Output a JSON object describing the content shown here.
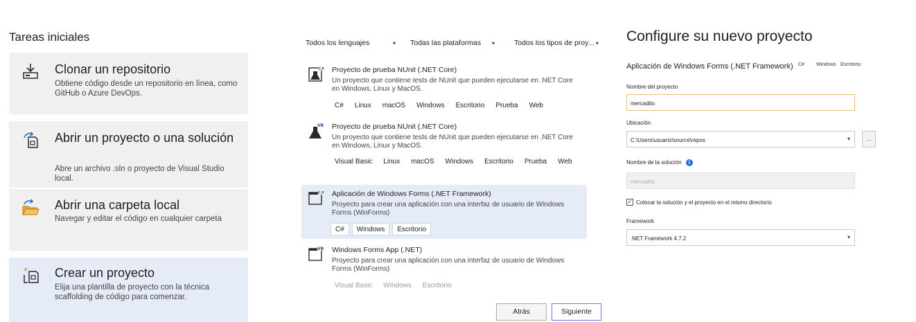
{
  "start": {
    "title": "Tareas iniciales",
    "tasks": [
      {
        "icon": "clone-icon",
        "title": "Clonar un repositorio",
        "desc": "Obtiene código desde un repositorio en línea, como GitHub o Azure DevOps."
      },
      {
        "icon": "open-project-icon",
        "title": "Abrir un proyecto o una solución",
        "desc": "Abre un archivo .sln o proyecto de Visual Studio local."
      },
      {
        "icon": "open-folder-icon",
        "title": "Abrir una carpeta local",
        "desc": "Navegar y editar el código en cualquier carpeta"
      },
      {
        "icon": "new-project-icon",
        "title": "Crear un proyecto",
        "desc": "Elija una plantilla de proyecto con la técnica scaffolding de código para comenzar."
      }
    ]
  },
  "templates": {
    "filters": {
      "language": "Todos los lenguajes",
      "platform": "Todas las plataformas",
      "type": "Todos los tipos de proy..."
    },
    "items": [
      {
        "icon": "csharp-test-icon",
        "name": "Proyecto de prueba NUnit (.NET Core)",
        "desc": "Un proyecto que contiene tests de NUnit que pueden ejecutarse en .NET Core en Windows, Linux y MacOS.",
        "tags": [
          "C#",
          "Linux",
          "macOS",
          "Windows",
          "Escritorio",
          "Prueba",
          "Web"
        ]
      },
      {
        "icon": "vb-test-icon",
        "name": "Proyecto de prueba NUnit (.NET Core)",
        "desc": "Un proyecto que contiene tests de NUnit que pueden ejecutarse en .NET Core en Windows, Linux y MacOS.",
        "tags": [
          "Visual Basic",
          "Linux",
          "macOS",
          "Windows",
          "Escritorio",
          "Prueba",
          "Web"
        ]
      },
      {
        "icon": "csharp-winforms-icon",
        "name": "Aplicación de Windows Forms (.NET Framework)",
        "desc": "Proyecto para crear una aplicación con una interfaz de usuario de Windows Forms (WinForms)",
        "tags": [
          "C#",
          "Windows",
          "Escritorio"
        ]
      },
      {
        "icon": "vb-winforms-icon",
        "name": "Windows Forms App (.NET)",
        "desc": "Proyecto para crear una aplicación con una interfaz de usuario de Windows Forms (WinForms)",
        "tags": [
          "Visual Basic",
          "Windows",
          "Escritorio"
        ]
      }
    ],
    "back_label": "Atrás",
    "next_label": "Siguiente"
  },
  "configure": {
    "title": "Configure su nuevo proyecto",
    "template_name": "Aplicación de Windows Forms (.NET Framework)",
    "template_tags": [
      "C#",
      "Windows",
      "Escritorio"
    ],
    "project_name_label": "Nombre del proyecto",
    "project_name_value": "mercadito",
    "location_label": "Ubicación",
    "location_value": "C:\\Users\\usuario\\source\\repos",
    "browse_label": "...",
    "solution_name_label": "Nombre de la solución",
    "solution_name_value": "mercadito",
    "same_dir_label": "Colocar la solución y el proyecto en el mismo directorio",
    "framework_label": "Framework",
    "framework_value": ".NET Framework 4.7.2"
  }
}
